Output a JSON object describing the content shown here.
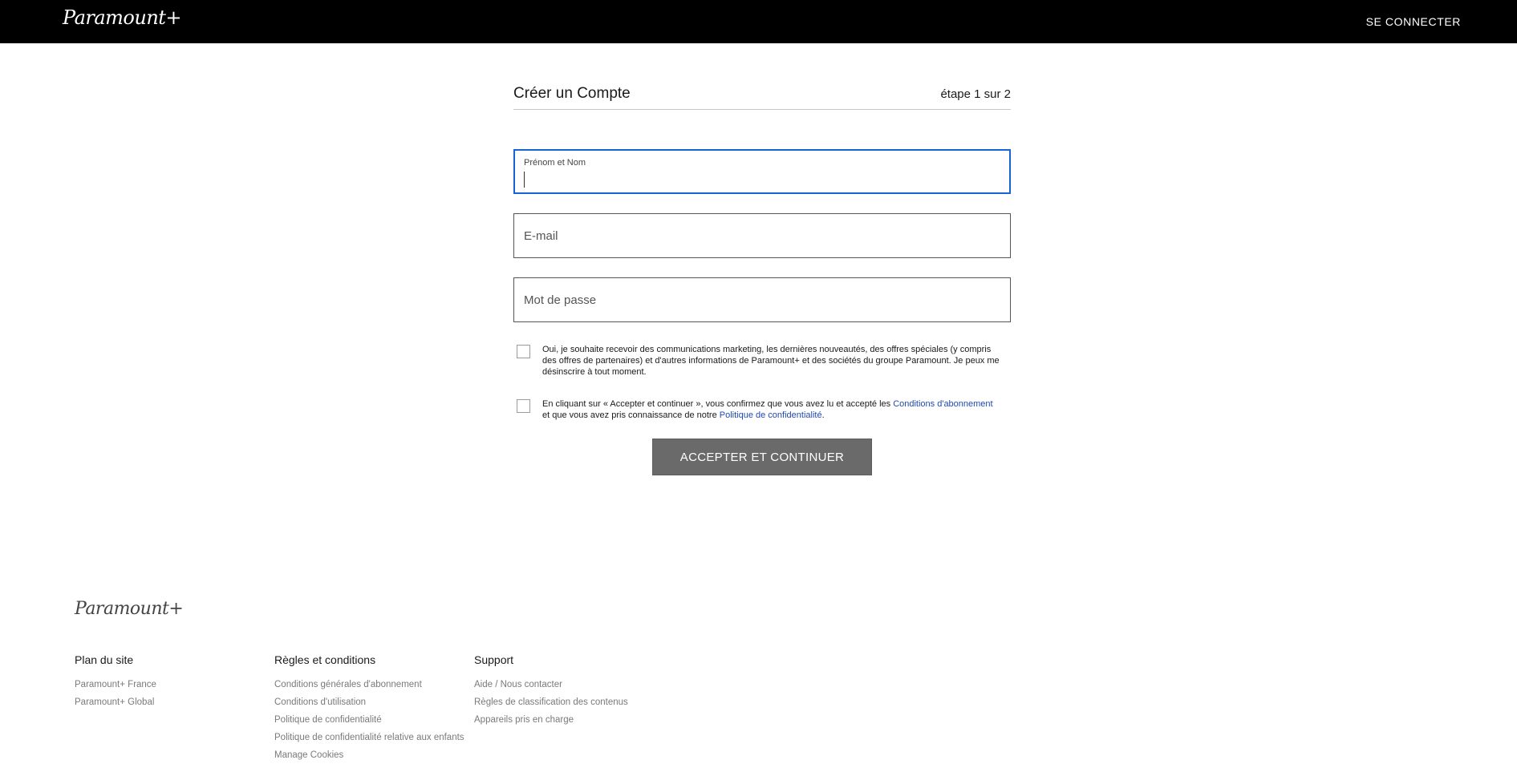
{
  "header": {
    "logo": "Paramount+",
    "signin_label": "SE CONNECTER"
  },
  "form": {
    "title": "Créer un Compte",
    "step": "étape 1 sur 2",
    "name_label": "Prénom et Nom",
    "email_placeholder": "E-mail",
    "password_placeholder": "Mot de passe",
    "marketing_text": "Oui, je souhaite recevoir des communications marketing, les dernières nouveautés, des offres spéciales (y compris des offres de partenaires) et d'autres informations de Paramount+ et des sociétés du groupe Paramount. Je peux me désinscrire à tout moment.",
    "terms_text_1": "En cliquant sur « Accepter et continuer », vous confirmez que vous avez lu et accepté les ",
    "terms_link_1": "Conditions d'abonnement",
    "terms_text_2": " et que vous avez pris connaissance de notre ",
    "terms_link_2": "Politique de confidentialité",
    "terms_text_3": ".",
    "submit_label": "ACCEPTER ET CONTINUER"
  },
  "footer": {
    "logo": "Paramount+",
    "columns": [
      {
        "heading": "Plan du site",
        "links": [
          "Paramount+ France",
          "Paramount+ Global"
        ]
      },
      {
        "heading": "Règles et conditions",
        "links": [
          "Conditions générales d'abonnement",
          "Conditions d'utilisation",
          "Politique de confidentialité",
          "Politique de confidentialité relative aux enfants",
          "Manage Cookies"
        ]
      },
      {
        "heading": "Support",
        "links": [
          "Aide / Nous contacter",
          "Règles de classification des contenus",
          "Appareils pris en charge"
        ]
      }
    ]
  },
  "colors": {
    "topbar": "#000000",
    "focus_border": "#1565d8",
    "link": "#1f49b6",
    "button_bg": "#6a6a6a"
  }
}
